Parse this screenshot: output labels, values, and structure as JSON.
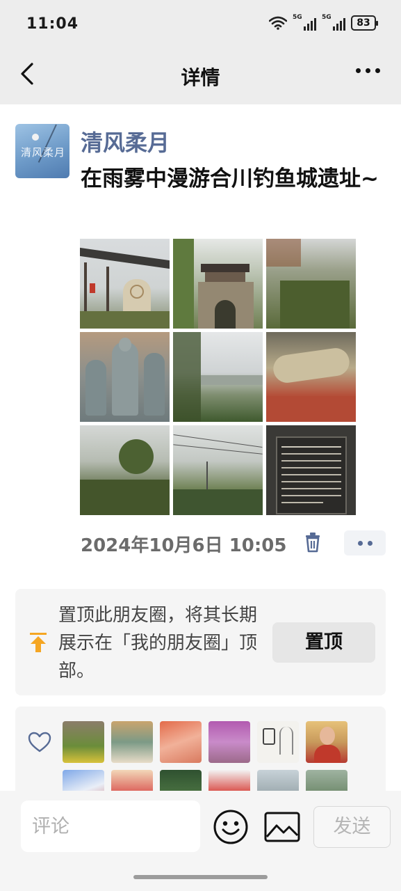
{
  "status_bar": {
    "time": "11:04",
    "network_1": "5G",
    "network_2": "5G",
    "battery": "83",
    "icons": [
      "wifi-icon",
      "signal-icon",
      "signal-icon",
      "battery-icon"
    ]
  },
  "nav": {
    "title": "详情",
    "back_icon": "chevron-left-icon",
    "more_icon": "more-dots-icon"
  },
  "post": {
    "author": "清风柔月",
    "avatar_text": "清风柔月",
    "text": "在雨雾中漫游合川钓鱼城遗址~",
    "timestamp": "2024年10月6日 10:05",
    "photos": [
      "pavilion-with-stone-stele",
      "ancient-city-gate",
      "hillside-forest",
      "stone-buddha-carvings",
      "misty-valley-view",
      "reclining-buddha-carving",
      "misty-trees",
      "misty-hills-with-power-lines",
      "information-signboard"
    ],
    "delete_icon": "trash-icon",
    "more_icon": "more-dots-icon"
  },
  "pin": {
    "text": "置顶此朋友圈，将其长期展示在「我的朋友圈」顶部。",
    "button": "置顶",
    "icon": "pin-top-icon",
    "accent": "#f5a623"
  },
  "likes": {
    "icon": "heart-icon",
    "avatars": [
      "liker-avatar",
      "liker-avatar",
      "liker-avatar",
      "liker-avatar",
      "liker-avatar",
      "liker-avatar",
      "liker-avatar",
      "liker-avatar",
      "liker-avatar",
      "liker-avatar",
      "liker-avatar",
      "liker-avatar"
    ]
  },
  "composer": {
    "placeholder": "评论",
    "send": "发送",
    "emoji_icon": "emoji-icon",
    "image_icon": "image-icon"
  },
  "colors": {
    "link_blue": "#576b95",
    "bar_bg": "#ededed",
    "card_bg": "#f5f5f5"
  }
}
